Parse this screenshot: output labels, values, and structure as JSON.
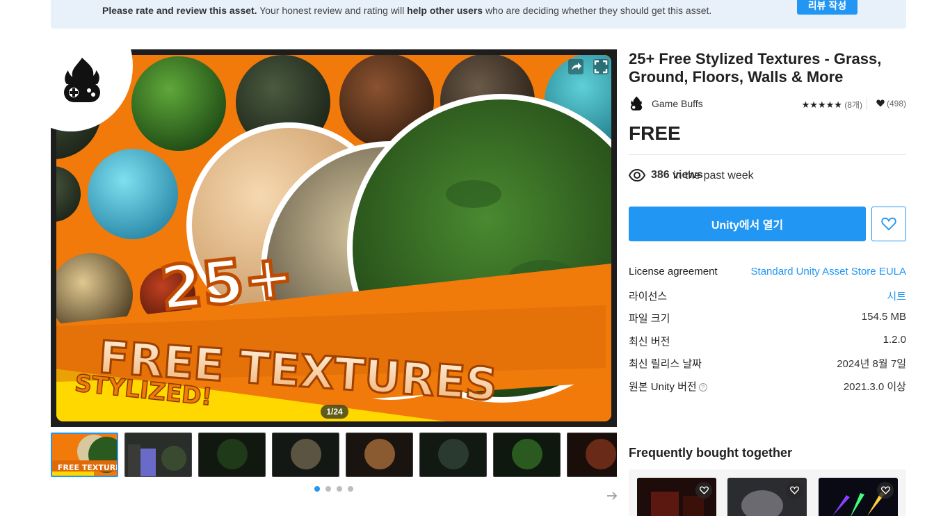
{
  "banner": {
    "text_bold1": "Please rate and review this asset.",
    "text_mid": " Your honest review and rating will ",
    "text_bold2": "help other users",
    "text_end": " who are deciding whether they should get this asset.",
    "button_label": "리뷰 작성"
  },
  "gallery": {
    "counter": "1/24",
    "hero_line1": "25+",
    "hero_line2": "FREE TEXTURES",
    "hero_line3": "STYLIZED!",
    "dots_count": 4,
    "active_dot": 0
  },
  "product": {
    "title": "25+ Free Stylized Textures - Grass, Ground, Floors, Walls & More",
    "publisher": "Game Buffs",
    "stars": "★★★★★",
    "rating_count": "(8개)",
    "favorites": "(498)",
    "price": "FREE",
    "views_count": "386 views",
    "views_suffix": " in the past week",
    "open_button": "Unity에서 열기"
  },
  "info": {
    "rows": [
      {
        "key": "License agreement",
        "value": "Standard Unity Asset Store EULA",
        "link": true
      },
      {
        "key": "라이선스",
        "value": "시트",
        "link": true
      },
      {
        "key": "파일 크기",
        "value": "154.5 MB",
        "link": false
      },
      {
        "key": "최신 버전",
        "value": "1.2.0",
        "link": false
      },
      {
        "key": "최신 릴리스 날짜",
        "value": "2024년 8월 7일",
        "link": false
      },
      {
        "key": "원본 Unity 버전",
        "value": "2021.3.0 이상",
        "link": false
      }
    ]
  },
  "fbt": {
    "title": "Frequently bought together"
  },
  "colors": {
    "accent": "#2196f3",
    "banner_bg": "#e8f1fa",
    "hero_orange": "#f17a0b"
  }
}
